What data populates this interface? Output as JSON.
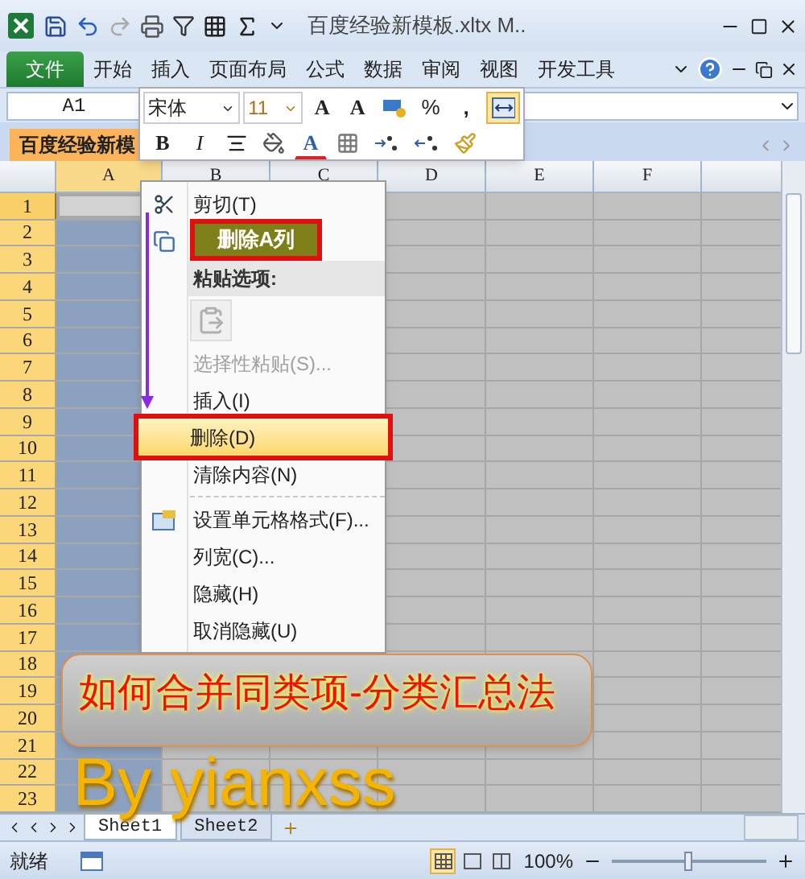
{
  "title_bar": {
    "title": "百度经验新模板.xltx M.."
  },
  "ribbon_tabs": [
    {
      "label": "文件",
      "kind": "file"
    },
    {
      "label": "开始",
      "kind": "tab"
    },
    {
      "label": "插入",
      "kind": "tab"
    },
    {
      "label": "页面布局",
      "kind": "tab"
    },
    {
      "label": "公式",
      "kind": "tab"
    },
    {
      "label": "数据",
      "kind": "tab"
    },
    {
      "label": "审阅",
      "kind": "tab"
    },
    {
      "label": "视图",
      "kind": "tab"
    },
    {
      "label": "开发工具",
      "kind": "tab"
    }
  ],
  "name_box": {
    "value": "A1"
  },
  "workbook_tab": {
    "label": "百度经验新模"
  },
  "mini_toolbar": {
    "font": "宋体",
    "size": "11",
    "row1": [
      {
        "kind": "grow",
        "label": "A",
        "on": false
      },
      {
        "kind": "shrink",
        "label": "A",
        "on": false
      },
      {
        "kind": "accounting",
        "on": false
      },
      {
        "kind": "percent",
        "label": "%",
        "on": false
      },
      {
        "kind": "comma",
        "label": ",",
        "on": false
      },
      {
        "kind": "merge",
        "on": true
      }
    ],
    "row2": [
      {
        "kind": "bold",
        "label": "B",
        "on": false
      },
      {
        "kind": "italic",
        "label": "I",
        "on": false
      },
      {
        "kind": "center",
        "on": false
      },
      {
        "kind": "fill",
        "on": false
      },
      {
        "kind": "fontcolor",
        "label": "A",
        "on": false
      },
      {
        "kind": "border",
        "on": false
      },
      {
        "kind": "incdec",
        "on": false
      },
      {
        "kind": "decdec",
        "on": false
      },
      {
        "kind": "brush",
        "on": false
      }
    ]
  },
  "columns": [
    {
      "label": "A",
      "selected": true
    },
    {
      "label": "B",
      "selected": false
    },
    {
      "label": "C",
      "selected": false
    },
    {
      "label": "D",
      "selected": false
    },
    {
      "label": "E",
      "selected": false
    },
    {
      "label": "F",
      "selected": false
    }
  ],
  "rows": [
    {
      "label": "1",
      "active": true
    },
    {
      "label": "2",
      "active": false
    },
    {
      "label": "3",
      "active": false
    },
    {
      "label": "4",
      "active": false
    },
    {
      "label": "5",
      "active": false
    },
    {
      "label": "6",
      "active": false
    },
    {
      "label": "7",
      "active": false
    },
    {
      "label": "8",
      "active": false
    },
    {
      "label": "9",
      "active": false
    },
    {
      "label": "10",
      "active": false
    },
    {
      "label": "11",
      "active": false
    },
    {
      "label": "12",
      "active": false
    },
    {
      "label": "13",
      "active": false
    },
    {
      "label": "14",
      "active": false
    },
    {
      "label": "15",
      "active": false
    },
    {
      "label": "16",
      "active": false
    },
    {
      "label": "17",
      "active": false
    },
    {
      "label": "18",
      "active": false
    },
    {
      "label": "19",
      "active": false
    },
    {
      "label": "20",
      "active": false
    },
    {
      "label": "21",
      "active": false
    },
    {
      "label": "22",
      "active": false
    },
    {
      "label": "23",
      "active": false
    }
  ],
  "context_menu": {
    "items": [
      {
        "kind": "cut",
        "label": "剪切(T)",
        "disabled": false,
        "selected": false
      },
      {
        "kind": "covered",
        "disabled": false,
        "selected": false
      },
      {
        "kind": "header",
        "label": "粘贴选项:",
        "disabled": false,
        "selected": false
      },
      {
        "kind": "paste",
        "disabled": true,
        "selected": false
      },
      {
        "kind": "command",
        "label": "选择性粘贴(S)...",
        "disabled": true,
        "selected": false
      },
      {
        "kind": "command",
        "label": "插入(I)",
        "disabled": false,
        "selected": false
      },
      {
        "kind": "command",
        "label": "删除(D)",
        "disabled": false,
        "selected": true
      },
      {
        "kind": "command",
        "label": "清除内容(N)",
        "disabled": false,
        "selected": false
      },
      {
        "kind": "separator"
      },
      {
        "kind": "format",
        "label": "设置单元格格式(F)...",
        "disabled": false,
        "selected": false
      },
      {
        "kind": "command",
        "label": "列宽(C)...",
        "disabled": false,
        "selected": false
      },
      {
        "kind": "command",
        "label": "隐藏(H)",
        "disabled": false,
        "selected": false
      },
      {
        "kind": "command",
        "label": "取消隐藏(U)",
        "disabled": false,
        "selected": false
      }
    ]
  },
  "callout": {
    "text": "删除A列"
  },
  "overlay_title": {
    "text": "如何合并同类项-分类汇总法"
  },
  "overlay_author": {
    "text": "By yianxss"
  },
  "sheet_tabs": [
    {
      "label": "Sheet1",
      "selected": true
    },
    {
      "label": "Sheet2",
      "selected": false
    }
  ],
  "status_bar": {
    "status": "就绪",
    "views": [
      {
        "kind": "normal",
        "selected": true
      },
      {
        "kind": "layout",
        "selected": false
      },
      {
        "kind": "pagebreak",
        "selected": false
      }
    ],
    "zoom": "100%",
    "zoom_slider": {
      "level": 0.5
    }
  }
}
